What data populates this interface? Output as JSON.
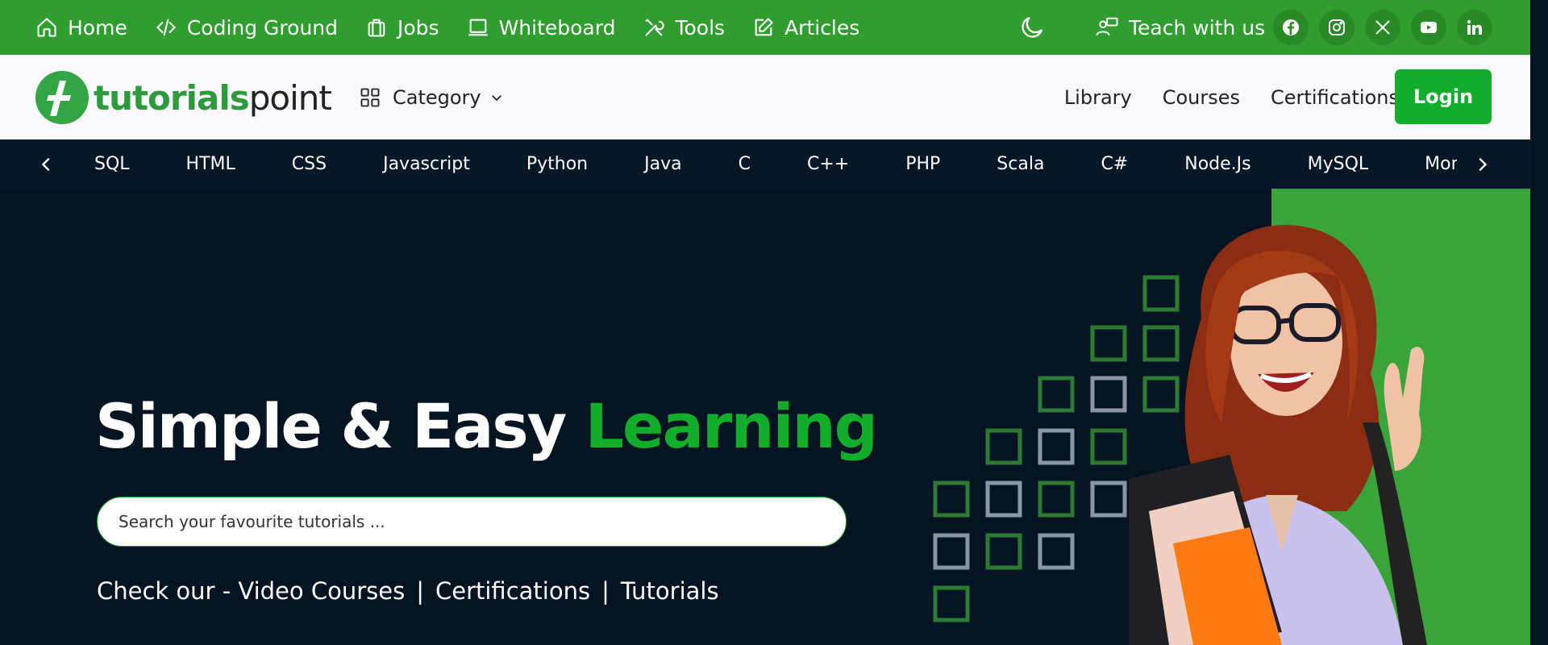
{
  "topbar": {
    "nav": [
      {
        "label": "Home",
        "icon": "home-icon"
      },
      {
        "label": "Coding Ground",
        "icon": "code-icon"
      },
      {
        "label": "Jobs",
        "icon": "briefcase-icon"
      },
      {
        "label": "Whiteboard",
        "icon": "whiteboard-icon"
      },
      {
        "label": "Tools",
        "icon": "tools-icon"
      },
      {
        "label": "Articles",
        "icon": "edit-icon"
      }
    ],
    "teach_label": "Teach with us",
    "socials": [
      "facebook-icon",
      "instagram-icon",
      "x-icon",
      "youtube-icon",
      "linkedin-icon"
    ],
    "color": "#2f9e2f"
  },
  "header": {
    "logo_part1": "tutorials",
    "logo_part2": "point",
    "category_label": "Category",
    "links": [
      "Library",
      "Courses",
      "Certifications"
    ],
    "login_label": "Login",
    "login_color": "#12ad2b"
  },
  "topics": [
    "SQL",
    "HTML",
    "CSS",
    "Javascript",
    "Python",
    "Java",
    "C",
    "C++",
    "PHP",
    "Scala",
    "C#",
    "Node.Js",
    "MySQL",
    "MongoDB"
  ],
  "hero": {
    "title_part1": "Simple & Easy ",
    "title_part2": "Learning",
    "search_placeholder": "Search your favourite tutorials ...",
    "check_prefix": "Check our - ",
    "check_links": [
      "Video Courses",
      "Certifications",
      "Tutorials"
    ],
    "sep": "|",
    "accent_color": "#12ad2b",
    "background": "#041423"
  }
}
